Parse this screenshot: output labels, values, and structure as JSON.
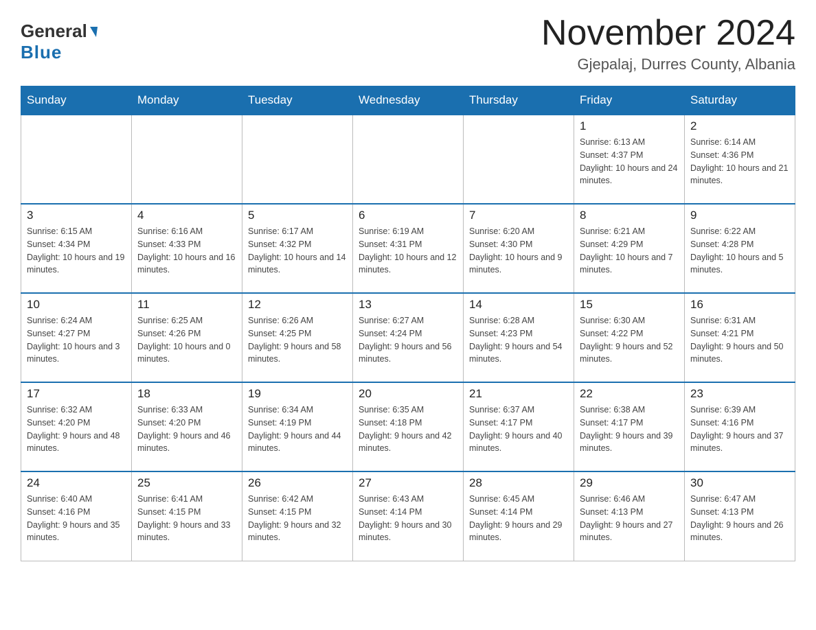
{
  "logo": {
    "general": "General",
    "blue": "Blue"
  },
  "title": "November 2024",
  "subtitle": "Gjepalaj, Durres County, Albania",
  "days_of_week": [
    "Sunday",
    "Monday",
    "Tuesday",
    "Wednesday",
    "Thursday",
    "Friday",
    "Saturday"
  ],
  "weeks": [
    [
      {
        "day": "",
        "info": ""
      },
      {
        "day": "",
        "info": ""
      },
      {
        "day": "",
        "info": ""
      },
      {
        "day": "",
        "info": ""
      },
      {
        "day": "",
        "info": ""
      },
      {
        "day": "1",
        "info": "Sunrise: 6:13 AM\nSunset: 4:37 PM\nDaylight: 10 hours and 24 minutes."
      },
      {
        "day": "2",
        "info": "Sunrise: 6:14 AM\nSunset: 4:36 PM\nDaylight: 10 hours and 21 minutes."
      }
    ],
    [
      {
        "day": "3",
        "info": "Sunrise: 6:15 AM\nSunset: 4:34 PM\nDaylight: 10 hours and 19 minutes."
      },
      {
        "day": "4",
        "info": "Sunrise: 6:16 AM\nSunset: 4:33 PM\nDaylight: 10 hours and 16 minutes."
      },
      {
        "day": "5",
        "info": "Sunrise: 6:17 AM\nSunset: 4:32 PM\nDaylight: 10 hours and 14 minutes."
      },
      {
        "day": "6",
        "info": "Sunrise: 6:19 AM\nSunset: 4:31 PM\nDaylight: 10 hours and 12 minutes."
      },
      {
        "day": "7",
        "info": "Sunrise: 6:20 AM\nSunset: 4:30 PM\nDaylight: 10 hours and 9 minutes."
      },
      {
        "day": "8",
        "info": "Sunrise: 6:21 AM\nSunset: 4:29 PM\nDaylight: 10 hours and 7 minutes."
      },
      {
        "day": "9",
        "info": "Sunrise: 6:22 AM\nSunset: 4:28 PM\nDaylight: 10 hours and 5 minutes."
      }
    ],
    [
      {
        "day": "10",
        "info": "Sunrise: 6:24 AM\nSunset: 4:27 PM\nDaylight: 10 hours and 3 minutes."
      },
      {
        "day": "11",
        "info": "Sunrise: 6:25 AM\nSunset: 4:26 PM\nDaylight: 10 hours and 0 minutes."
      },
      {
        "day": "12",
        "info": "Sunrise: 6:26 AM\nSunset: 4:25 PM\nDaylight: 9 hours and 58 minutes."
      },
      {
        "day": "13",
        "info": "Sunrise: 6:27 AM\nSunset: 4:24 PM\nDaylight: 9 hours and 56 minutes."
      },
      {
        "day": "14",
        "info": "Sunrise: 6:28 AM\nSunset: 4:23 PM\nDaylight: 9 hours and 54 minutes."
      },
      {
        "day": "15",
        "info": "Sunrise: 6:30 AM\nSunset: 4:22 PM\nDaylight: 9 hours and 52 minutes."
      },
      {
        "day": "16",
        "info": "Sunrise: 6:31 AM\nSunset: 4:21 PM\nDaylight: 9 hours and 50 minutes."
      }
    ],
    [
      {
        "day": "17",
        "info": "Sunrise: 6:32 AM\nSunset: 4:20 PM\nDaylight: 9 hours and 48 minutes."
      },
      {
        "day": "18",
        "info": "Sunrise: 6:33 AM\nSunset: 4:20 PM\nDaylight: 9 hours and 46 minutes."
      },
      {
        "day": "19",
        "info": "Sunrise: 6:34 AM\nSunset: 4:19 PM\nDaylight: 9 hours and 44 minutes."
      },
      {
        "day": "20",
        "info": "Sunrise: 6:35 AM\nSunset: 4:18 PM\nDaylight: 9 hours and 42 minutes."
      },
      {
        "day": "21",
        "info": "Sunrise: 6:37 AM\nSunset: 4:17 PM\nDaylight: 9 hours and 40 minutes."
      },
      {
        "day": "22",
        "info": "Sunrise: 6:38 AM\nSunset: 4:17 PM\nDaylight: 9 hours and 39 minutes."
      },
      {
        "day": "23",
        "info": "Sunrise: 6:39 AM\nSunset: 4:16 PM\nDaylight: 9 hours and 37 minutes."
      }
    ],
    [
      {
        "day": "24",
        "info": "Sunrise: 6:40 AM\nSunset: 4:16 PM\nDaylight: 9 hours and 35 minutes."
      },
      {
        "day": "25",
        "info": "Sunrise: 6:41 AM\nSunset: 4:15 PM\nDaylight: 9 hours and 33 minutes."
      },
      {
        "day": "26",
        "info": "Sunrise: 6:42 AM\nSunset: 4:15 PM\nDaylight: 9 hours and 32 minutes."
      },
      {
        "day": "27",
        "info": "Sunrise: 6:43 AM\nSunset: 4:14 PM\nDaylight: 9 hours and 30 minutes."
      },
      {
        "day": "28",
        "info": "Sunrise: 6:45 AM\nSunset: 4:14 PM\nDaylight: 9 hours and 29 minutes."
      },
      {
        "day": "29",
        "info": "Sunrise: 6:46 AM\nSunset: 4:13 PM\nDaylight: 9 hours and 27 minutes."
      },
      {
        "day": "30",
        "info": "Sunrise: 6:47 AM\nSunset: 4:13 PM\nDaylight: 9 hours and 26 minutes."
      }
    ]
  ]
}
